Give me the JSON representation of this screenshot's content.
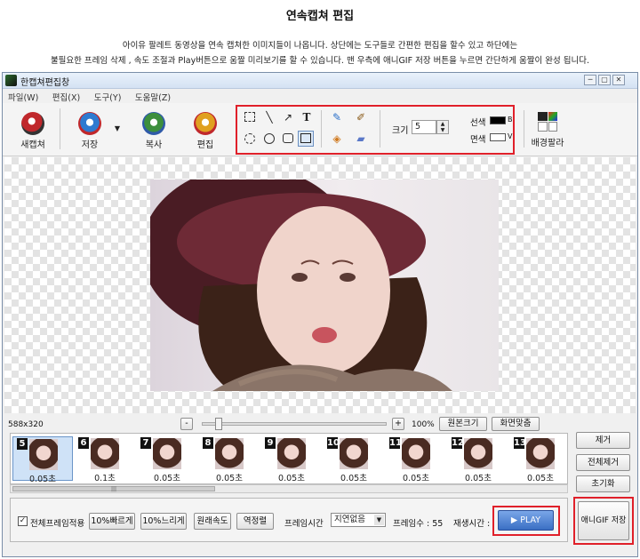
{
  "header": {
    "title": "연속캡쳐 편집",
    "line1": "아이유 팔레트 동영상을 연속 캡쳐한 이미지들이 나옵니다.  상단에는 도구들로 간편한 편집을 할수 있고  하단에는",
    "line2": "불필요한 프레임 삭제 , 속도 조절과  Play버튼으로 움짤 미리보기를 할 수 있습니다. 맨 우측에  애니GIF 저장 버튼을 누르면 간단하게 움짤이 완성 됩니다."
  },
  "window": {
    "title": "한캡쳐편집창",
    "controls": [
      "─",
      "▢",
      "✕"
    ]
  },
  "menu": [
    "파일(W)",
    "편집(X)",
    "도구(Y)",
    "도움말(Z)"
  ],
  "toolbar": {
    "new_capture": "새캡쳐",
    "save": "저장",
    "copy": "복사",
    "edit": "편집",
    "size_label": "크기",
    "size_value": "5",
    "line_color_label": "선색",
    "line_color_code": "B",
    "fill_color_label": "면색",
    "fill_color_code": "V",
    "bg_palette": "배경팔라",
    "line_color": "#000000",
    "fill_color": "#ffffff"
  },
  "status": {
    "dimensions": "588x320",
    "zoom_minus": "-",
    "zoom_plus": "+",
    "zoom": "100%",
    "original_size": "원본크기",
    "fit_screen": "화면맞춤",
    "zoom_slider": 0.07
  },
  "frames": [
    {
      "num": "5",
      "dur": "0.05초"
    },
    {
      "num": "6",
      "dur": "0.1초"
    },
    {
      "num": "7",
      "dur": "0.05초"
    },
    {
      "num": "8",
      "dur": "0.05초"
    },
    {
      "num": "9",
      "dur": "0.05초"
    },
    {
      "num": "10",
      "dur": "0.05초"
    },
    {
      "num": "11",
      "dur": "0.05초"
    },
    {
      "num": "12",
      "dur": "0.05초"
    },
    {
      "num": "13",
      "dur": "0.05초"
    }
  ],
  "scroll_grip": "|||",
  "side": {
    "remove": "제거",
    "remove_all": "전체제거",
    "reset": "초기화"
  },
  "bottom": {
    "apply_all": "전체프레임적용",
    "faster": "10%빠르게",
    "slower": "10%느리게",
    "original_speed": "원래속도",
    "reverse": "역정렬",
    "frame_time_label": "프레임시간",
    "frame_time_value": "지연없음",
    "frame_count": "프레임수 :  55",
    "play_time_label": "재생시간 :",
    "play": "▶ PLAY",
    "gif_save": "애니GIF 저장"
  }
}
